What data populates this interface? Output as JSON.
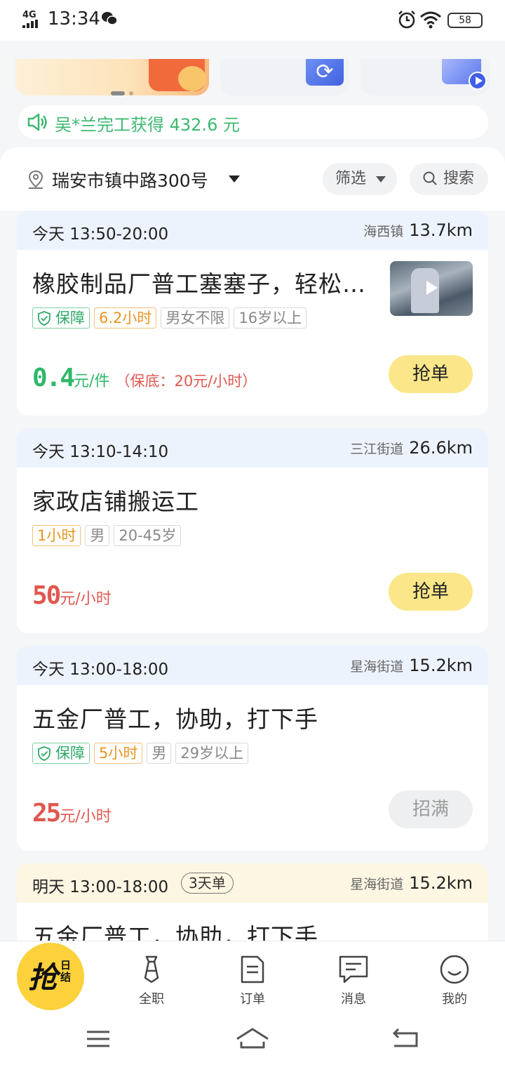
{
  "status_bar": {
    "network": "4G",
    "time": "13:34",
    "battery": "58"
  },
  "notice": {
    "text": "吴*兰完工获得 432.6 元"
  },
  "location": {
    "address": "瑞安市镇中路300号"
  },
  "toolbar": {
    "filter_label": "筛选",
    "search_label": "搜索"
  },
  "jobs": [
    {
      "date_time": "今天 13:50-20:00",
      "area": "海西镇",
      "distance": "13.7km",
      "title": "橡胶制品厂普工塞塞子，轻松简单",
      "guarantee": "保障",
      "hours": "6.2小时",
      "tags": [
        "男女不限",
        "16岁以上"
      ],
      "price_num": "0.4",
      "price_unit": "元/件",
      "price_min": "（保底：20元/小时）",
      "action": "抢单"
    },
    {
      "date_time": "今天 13:10-14:10",
      "area": "三江街道",
      "distance": "26.6km",
      "title": "家政店铺搬运工",
      "hours": "1小时",
      "tags": [
        "男",
        "20-45岁"
      ],
      "price_num": "50",
      "price_unit": "元/小时",
      "action": "抢单"
    },
    {
      "date_time": "今天 13:00-18:00",
      "area": "星海街道",
      "distance": "15.2km",
      "title": "五金厂普工，协助，打下手",
      "guarantee": "保障",
      "hours": "5小时",
      "tags": [
        "男",
        "29岁以上"
      ],
      "price_num": "25",
      "price_unit": "元/小时",
      "action": "招满"
    },
    {
      "date_time": "明天 13:00-18:00",
      "days_badge": "3天单",
      "area": "星海街道",
      "distance": "15.2km",
      "title": "五金厂普工，协助，打下手"
    }
  ],
  "bottom_nav": {
    "grab": "抢",
    "grab_sub": "日结",
    "fulltime": "全职",
    "orders": "订单",
    "messages": "消息",
    "mine": "我的"
  },
  "colors": {
    "accent_yellow": "#fcd13c",
    "button_yellow": "#fbe78a",
    "price_green": "#2eb86a",
    "price_red": "#e0574f",
    "notice_green": "#3cb971"
  }
}
